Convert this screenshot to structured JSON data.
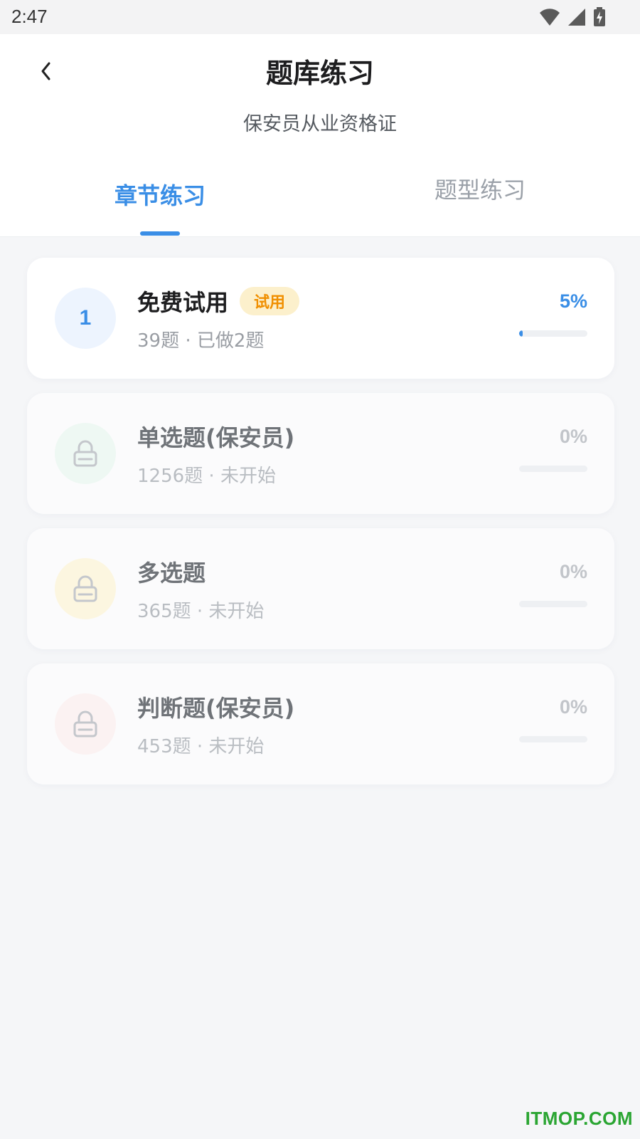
{
  "status_bar": {
    "time": "2:47",
    "icons": [
      "wifi-icon",
      "signal-icon",
      "battery-charging-icon"
    ]
  },
  "header": {
    "back_icon": "chevron-left-icon",
    "title": "题库练习",
    "subtitle": "保安员从业资格证"
  },
  "tabs": [
    {
      "label": "章节练习",
      "active": true
    },
    {
      "label": "题型练习",
      "active": false
    }
  ],
  "chapters": [
    {
      "number": "1",
      "title": "免费试用",
      "badge": "试用",
      "meta": "39题 · 已做2题",
      "percent_label": "5%",
      "progress": 0.05,
      "locked": false,
      "circle_color": "#edf4fe"
    },
    {
      "icon": "lock-icon",
      "title": "单选题(保安员)",
      "meta": "1256题 · 未开始",
      "percent_label": "0%",
      "progress": 0,
      "locked": true,
      "circle_color": "#eef8f3"
    },
    {
      "icon": "lock-icon",
      "title": "多选题",
      "meta": "365题 · 未开始",
      "percent_label": "0%",
      "progress": 0,
      "locked": true,
      "circle_color": "#fcf6e0"
    },
    {
      "icon": "lock-icon",
      "title": "判断题(保安员)",
      "meta": "453题 · 未开始",
      "percent_label": "0%",
      "progress": 0,
      "locked": true,
      "circle_color": "#fbf2f2"
    }
  ],
  "colors": {
    "accent": "#3a8ee6",
    "badge_bg": "#fcf0cc",
    "badge_text": "#f08f00",
    "watermark": "#2aa532"
  },
  "watermark": "ITMOP.COM"
}
